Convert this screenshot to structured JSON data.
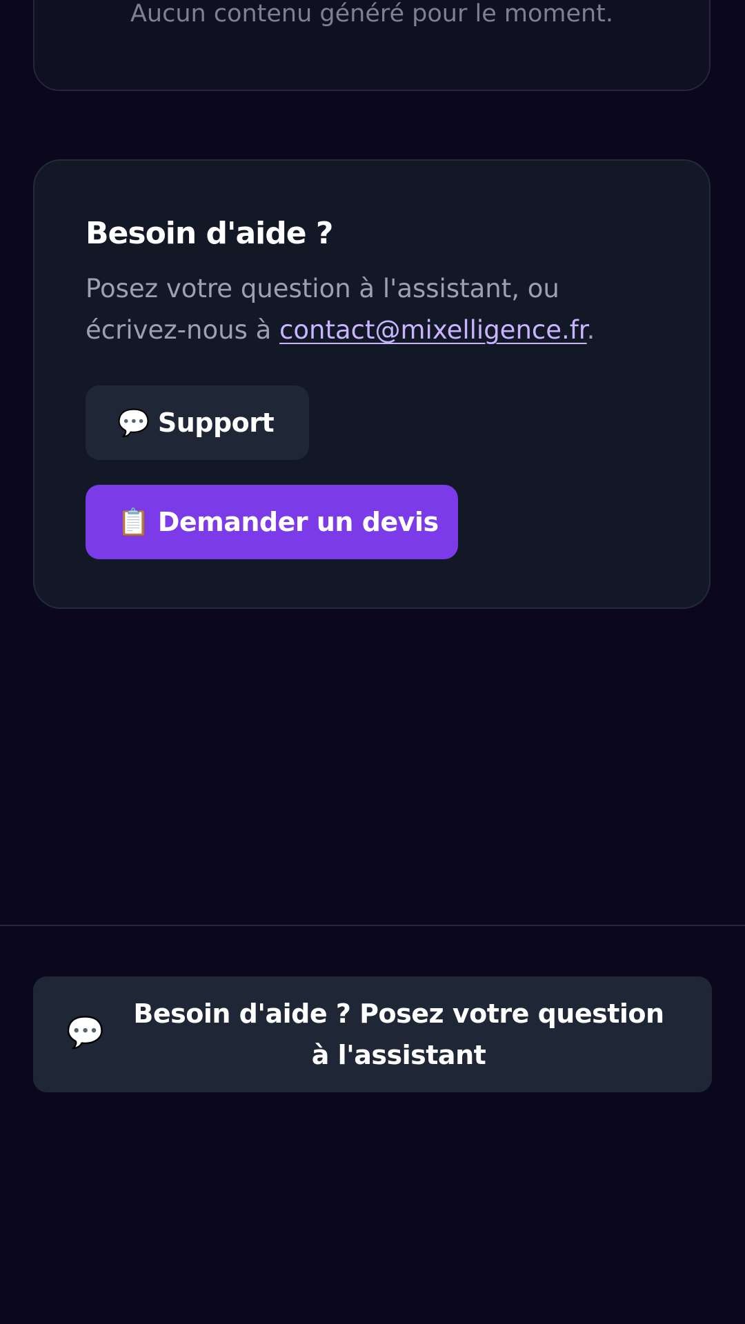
{
  "empty_state": {
    "text": "Aucun contenu généré pour le moment."
  },
  "help_card": {
    "title": "Besoin d'aide ?",
    "description_prefix": "Posez votre question à l'assistant, ou écrivez-nous à ",
    "email": "contact@mixelligence.fr",
    "description_suffix": ".",
    "support_button": {
      "icon": "speech-bubble-icon",
      "icon_glyph": "💬",
      "label": "Support"
    },
    "quote_button": {
      "icon": "clipboard-icon",
      "icon_glyph": "📋",
      "label": "Demander un devis"
    }
  },
  "assistant_bar": {
    "icon": "speech-bubble-icon",
    "icon_glyph": "💬",
    "label": "Besoin d'aide ? Posez votre question à l'assistant"
  },
  "colors": {
    "background": "#0b071c",
    "card": "#131827",
    "accent": "#7b3be8",
    "link": "#c9b5ff",
    "secondary_button": "#1f2635"
  }
}
